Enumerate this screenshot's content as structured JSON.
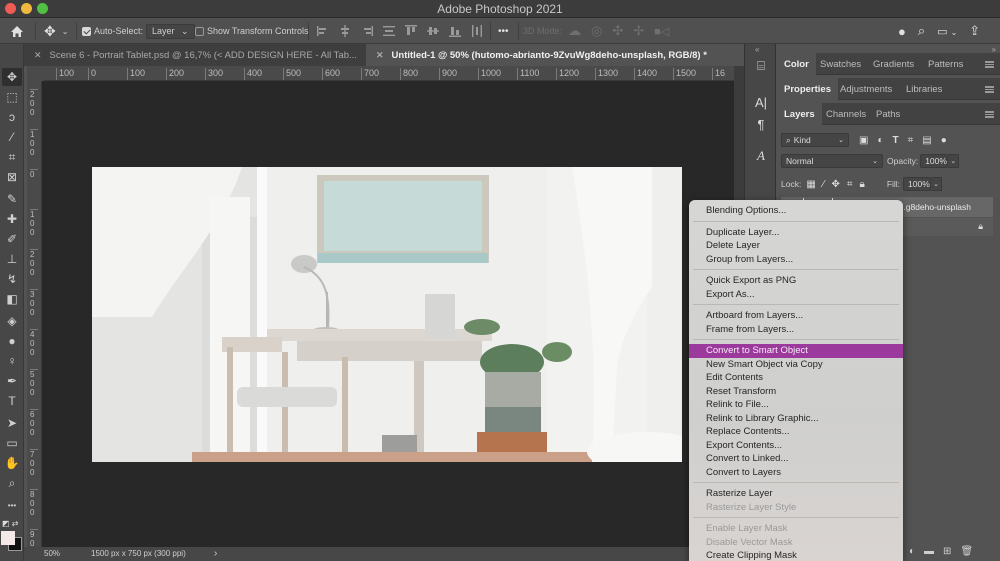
{
  "window": {
    "title": "Adobe Photoshop 2021",
    "traffic_lights": [
      {
        "name": "close",
        "color": "#ee5c55"
      },
      {
        "name": "minimize",
        "color": "#f1b83e"
      },
      {
        "name": "maximize",
        "color": "#52c143"
      }
    ]
  },
  "options_bar": {
    "home_icon": "home-icon",
    "move_tool_icon": "move-icon",
    "auto_select_label": "Auto-Select:",
    "auto_select_checked": true,
    "auto_select_target": "Layer",
    "show_transform_controls_label": "Show Transform Controls",
    "show_transform_controls_checked": false,
    "more_label": "•••",
    "mode_3d_label": "3D Mode:",
    "right_icons": [
      "share-user-icon",
      "search-icon",
      "workspace-icon",
      "share-icon"
    ]
  },
  "document_tabs": [
    {
      "label": "Scene 6 - Portrait Tablet.psd @ 16,7% (< ADD DESIGN HERE - All Tab...",
      "active": false
    },
    {
      "label": "Untitled-1 @ 50% (hutomo-abrianto-9ZvuWg8deho-unsplash, RGB/8) *",
      "active": true
    }
  ],
  "rulers": {
    "horizontal": [
      "100",
      "0",
      "100",
      "200",
      "300",
      "400",
      "500",
      "600",
      "700",
      "800",
      "900",
      "1000",
      "1100",
      "1200",
      "1300",
      "1400",
      "1500",
      "16"
    ],
    "vertical": [
      "200",
      "100",
      "0",
      "100",
      "200",
      "300",
      "400",
      "500",
      "600",
      "700",
      "800",
      "900"
    ]
  },
  "toolbar": {
    "tools": [
      {
        "name": "move-tool",
        "glyph": "✥",
        "active": true
      },
      {
        "name": "marquee-tool",
        "glyph": "⬚"
      },
      {
        "name": "lasso-tool",
        "glyph": "ↄ"
      },
      {
        "name": "magic-wand-tool",
        "glyph": "⁄"
      },
      {
        "name": "crop-tool",
        "glyph": "⌗"
      },
      {
        "name": "frame-tool",
        "glyph": "⊠"
      },
      {
        "name": "eyedropper-tool",
        "glyph": "✎"
      },
      {
        "name": "healing-brush-tool",
        "glyph": "✚"
      },
      {
        "name": "brush-tool",
        "glyph": "✐"
      },
      {
        "name": "clone-stamp-tool",
        "glyph": "⊥"
      },
      {
        "name": "history-brush-tool",
        "glyph": "↯"
      },
      {
        "name": "eraser-tool",
        "glyph": "◧"
      },
      {
        "name": "paint-bucket-tool",
        "glyph": "◈"
      },
      {
        "name": "blur-tool",
        "glyph": "●"
      },
      {
        "name": "dodge-tool",
        "glyph": "♀"
      },
      {
        "name": "pen-tool",
        "glyph": "✒"
      },
      {
        "name": "type-tool",
        "glyph": "T"
      },
      {
        "name": "path-selection-tool",
        "glyph": "➤"
      },
      {
        "name": "rectangle-tool",
        "glyph": "▭"
      },
      {
        "name": "hand-tool",
        "glyph": "✋"
      },
      {
        "name": "zoom-tool",
        "glyph": "⌕"
      },
      {
        "name": "edit-toolbar",
        "glyph": "•••"
      }
    ],
    "foreground_color": "#f5e8e8",
    "background_color": "#111111"
  },
  "status_bar": {
    "zoom": "50%",
    "doc_info": "1500 px x 750 px (300 ppi)",
    "arrow": "›"
  },
  "panels": {
    "color_group": {
      "tabs": [
        "Color",
        "Swatches",
        "Gradients",
        "Patterns"
      ],
      "active": "Color"
    },
    "properties_group": {
      "tabs": [
        "Properties",
        "Adjustments",
        "Libraries"
      ],
      "active": "Properties"
    },
    "layers_group": {
      "tabs": [
        "Layers",
        "Channels",
        "Paths"
      ],
      "active": "Layers"
    },
    "layers": {
      "filter_kind": "Kind",
      "blend_mode": "Normal",
      "opacity_label": "Opacity:",
      "opacity_value": "100%",
      "lock_label": "Lock:",
      "fill_label": "Fill:",
      "fill_value": "100%",
      "layer_name_visible": "..g8deho-unsplash",
      "footer_icons": [
        "adjustment-layer-icon",
        "group-folder-icon",
        "new-layer-icon",
        "trash-icon"
      ]
    }
  },
  "context_menu": {
    "items": [
      {
        "label": "Blending Options...",
        "state": "normal"
      },
      {
        "sep": true
      },
      {
        "label": "Duplicate Layer...",
        "state": "normal"
      },
      {
        "label": "Delete Layer",
        "state": "normal"
      },
      {
        "label": "Group from Layers...",
        "state": "normal"
      },
      {
        "sep": true
      },
      {
        "label": "Quick Export as PNG",
        "state": "normal"
      },
      {
        "label": "Export As...",
        "state": "normal"
      },
      {
        "sep": true
      },
      {
        "label": "Artboard from Layers...",
        "state": "normal"
      },
      {
        "label": "Frame from Layers...",
        "state": "normal"
      },
      {
        "sep": true
      },
      {
        "label": "Convert to Smart Object",
        "state": "highlighted"
      },
      {
        "label": "New Smart Object via Copy",
        "state": "normal"
      },
      {
        "label": "Edit Contents",
        "state": "normal"
      },
      {
        "label": "Reset Transform",
        "state": "normal"
      },
      {
        "label": "Relink to File...",
        "state": "normal"
      },
      {
        "label": "Relink to Library Graphic...",
        "state": "normal"
      },
      {
        "label": "Replace Contents...",
        "state": "normal"
      },
      {
        "label": "Export Contents...",
        "state": "normal"
      },
      {
        "label": "Convert to Linked...",
        "state": "normal"
      },
      {
        "label": "Convert to Layers",
        "state": "normal"
      },
      {
        "sep": true
      },
      {
        "label": "Rasterize Layer",
        "state": "normal"
      },
      {
        "label": "Rasterize Layer Style",
        "state": "disabled"
      },
      {
        "sep": true
      },
      {
        "label": "Enable Layer Mask",
        "state": "disabled"
      },
      {
        "label": "Disable Vector Mask",
        "state": "disabled"
      },
      {
        "label": "Create Clipping Mask",
        "state": "normal"
      }
    ],
    "highlight_color": "#9b3a9c"
  }
}
